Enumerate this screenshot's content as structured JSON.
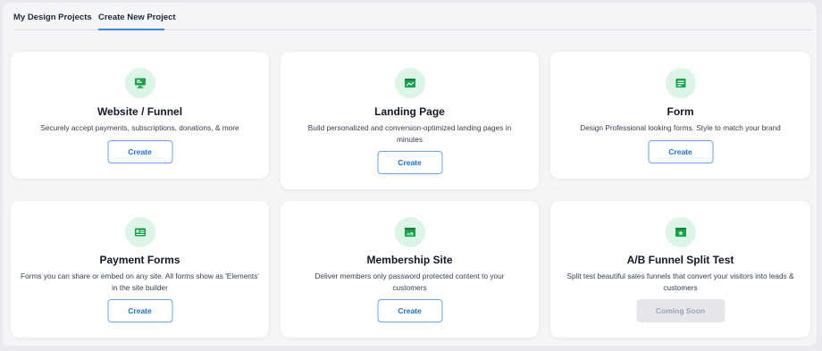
{
  "tabs": [
    {
      "label": "My Design Projects"
    },
    {
      "label": "Create New Project"
    }
  ],
  "cards": [
    {
      "title": "Website / Funnel",
      "description": "Securely accept payments, subscriptions, donations, & more",
      "button": "Create",
      "icon": "website-icon"
    },
    {
      "title": "Landing Page",
      "description": "Build personalized and conversion-optimized landing pages in minutes",
      "button": "Create",
      "icon": "landing-page-icon"
    },
    {
      "title": "Form",
      "description": "Design Professional looking forms. Style to match your brand",
      "button": "Create",
      "icon": "form-icon"
    },
    {
      "title": "Payment Forms",
      "description": "Forms you can share or embed on any site. All forms show as 'Elements' in the site builder",
      "button": "Create",
      "icon": "payment-form-icon"
    },
    {
      "title": "Membership Site",
      "description": "Deliver members only password protected content to your customers",
      "button": "Create",
      "icon": "membership-icon"
    },
    {
      "title": "A/B Funnel Split Test",
      "description": "Split test beautiful sales funnels that convert your visitors into leads & customers",
      "button": "Coming Soon",
      "icon": "split-test-icon"
    }
  ],
  "colors": {
    "accent": "#3b82f6",
    "icon_bg": "#dcf5e6",
    "icon_fg": "#16a34a"
  }
}
